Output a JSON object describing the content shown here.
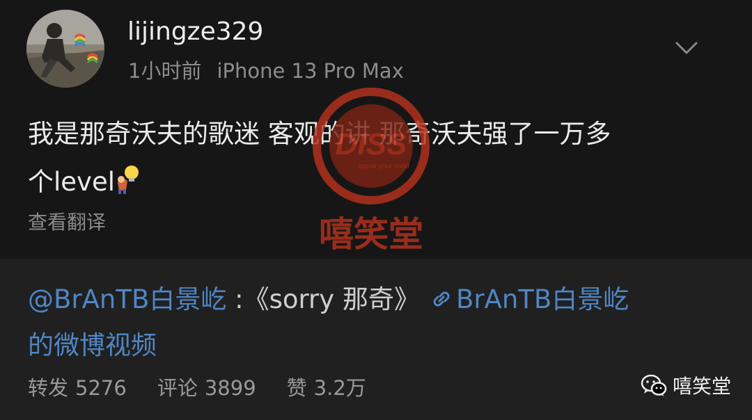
{
  "post": {
    "username": "lijingze329",
    "time": "1小时前",
    "device": "iPhone 13 Pro Max",
    "content_line1": "我是那奇沃夫的歌迷 客观的讲 那奇沃夫强了一万多",
    "content_line2": "个level",
    "content_emoji": "lightbulb-person-emoji",
    "translate_label": "查看翻译"
  },
  "repost": {
    "mention": "@BrAnTB白景屹",
    "separator": " :",
    "title": "《sorry 那奇》",
    "link_text": "BrAnTB白景屹",
    "line2": "的微博视频"
  },
  "stats": {
    "repost_label": "转发",
    "repost_count": "5276",
    "comment_label": "评论",
    "comment_count": "3899",
    "like_label": "赞",
    "like_count": "3.2万"
  },
  "watermark": {
    "logo_text": "DISS",
    "tagline": "speak your mind",
    "name": "嘻笑堂"
  },
  "brand": {
    "icon": "wechat-icon",
    "name": "嘻笑堂"
  },
  "colors": {
    "post_bg": "#161616",
    "repost_bg": "#202020",
    "link": "#4f86c4",
    "muted": "#8d8d8d",
    "watermark_red": "#b8321e"
  }
}
